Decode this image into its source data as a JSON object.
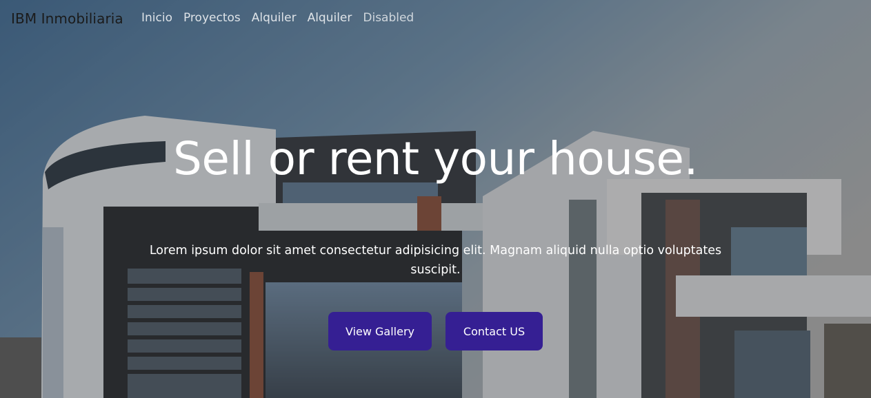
{
  "navbar": {
    "brand": "IBM Inmobiliaria",
    "links": [
      {
        "label": "Inicio"
      },
      {
        "label": "Proyectos"
      },
      {
        "label": "Alquiler"
      },
      {
        "label": "Alquiler"
      },
      {
        "label": "Disabled"
      }
    ]
  },
  "hero": {
    "headline": "Sell or rent your house.",
    "lead": "Lorem ipsum dolor sit amet consectetur adipisicing elit. Magnam aliquid nulla optio voluptates suscipit.",
    "buttons": {
      "gallery": "View Gallery",
      "contact": "Contact US"
    }
  },
  "colors": {
    "button_bg": "#351f93",
    "overlay": "rgba(60,60,60,0.38)"
  }
}
